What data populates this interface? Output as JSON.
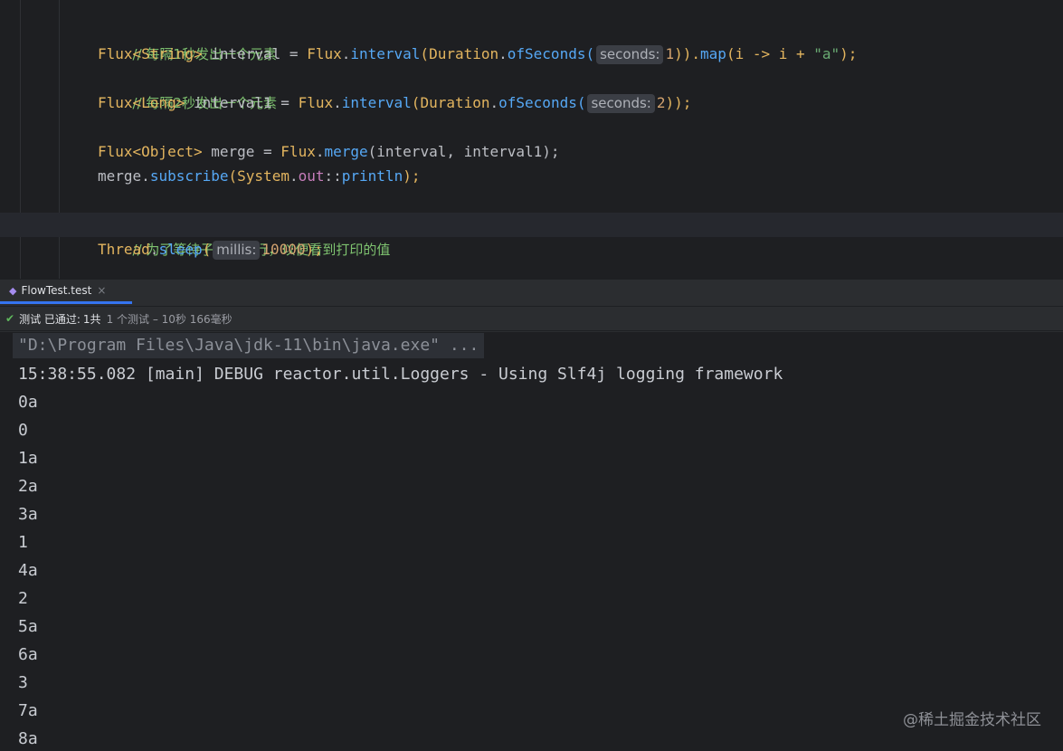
{
  "editor": {
    "comment1": "// 每隔1秒发出一个元素",
    "line1": {
      "type": "Flux<String>",
      "text1": " interval = ",
      "cls": "Flux",
      "dot1": ".",
      "m1": "interval",
      "p1": "(",
      "cls2": "Duration",
      "dot2": ".",
      "m2": "ofSeconds",
      "p2": "(",
      "hint": "seconds:",
      "num": "1",
      "p3": ")).",
      "m3": "map",
      "p4": "(i -> i + ",
      "str": "\"a\"",
      "end": ");"
    },
    "comment2": "// 每隔2秒发出一个元素",
    "line2": {
      "type": "Flux<Long>",
      "text1": " interval1 = ",
      "cls": "Flux",
      "dot1": ".",
      "m1": "interval",
      "p1": "(",
      "cls2": "Duration",
      "dot2": ".",
      "m2": "ofSeconds",
      "p2": "(",
      "hint": "seconds:",
      "num": "2",
      "end": "));"
    },
    "line3": {
      "type": "Flux<Object>",
      "text1": " merge = ",
      "cls": "Flux",
      "dot1": ".",
      "m1": "merge",
      "end": "(interval, interval1);"
    },
    "line4": {
      "obj": "merge",
      "dot1": ".",
      "m1": "subscribe",
      "p1": "(",
      "cls": "System",
      "dot2": ".",
      "field": "out",
      "sep": "::",
      "m2": "println",
      "end": ");"
    },
    "comment3": "// 为了等待子线程执行，以便看到打印的值",
    "line5": {
      "cls": "Thread",
      "dot1": ".",
      "m1": "sleep",
      "p1": "(",
      "hint": "millis:",
      "num": "10000",
      "end": ");"
    }
  },
  "tab": {
    "label": "FlowTest.test",
    "close": "×"
  },
  "status": {
    "check": "✔",
    "label": "测试 已通过:",
    "count": "1共",
    "detail": "1 个测试 – 10秒 166毫秒"
  },
  "console": {
    "command": "\"D:\\Program Files\\Java\\jdk-11\\bin\\java.exe\" ...",
    "lines": [
      "15:38:55.082 [main] DEBUG reactor.util.Loggers - Using Slf4j logging framework",
      "0a",
      "0",
      "1a",
      "2a",
      "3a",
      "1",
      "4a",
      "2",
      "5a",
      "6a",
      "3",
      "7a",
      "8a"
    ]
  },
  "watermark": "@稀土掘金技术社区"
}
